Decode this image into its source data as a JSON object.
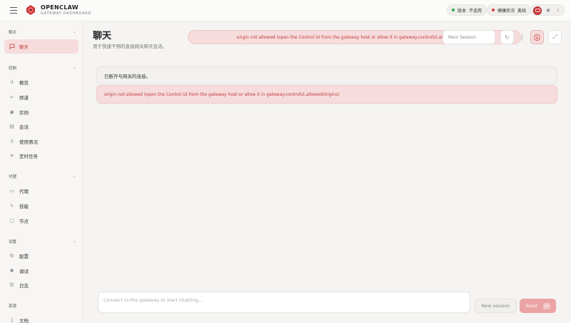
{
  "app": {
    "brand_title": "OPENCLAW",
    "brand_subtitle": "GATEWAY DASHBOARD",
    "accent": "#c23b3b"
  },
  "header": {
    "version_label": "版本",
    "version_value": "不适用",
    "health_label": "健康状况",
    "health_value": "离线",
    "health_color": "#d13b3b",
    "version_color": "#2fa84f"
  },
  "sidebar": {
    "sections": [
      {
        "title": "聊天",
        "items": [
          {
            "label": "聊天",
            "icon": "message-square-icon",
            "active": true
          }
        ]
      },
      {
        "title": "控制",
        "items": [
          {
            "label": "概览",
            "icon": "bar-chart-icon"
          },
          {
            "label": "频道",
            "icon": "link-icon"
          },
          {
            "label": "实例",
            "icon": "radio-icon"
          },
          {
            "label": "会话",
            "icon": "file-text-icon"
          },
          {
            "label": "使用情况",
            "icon": "bar-chart-icon"
          },
          {
            "label": "定时任务",
            "icon": "loader-icon"
          }
        ]
      },
      {
        "title": "代理",
        "items": [
          {
            "label": "代理",
            "icon": "folder-icon"
          },
          {
            "label": "技能",
            "icon": "zap-icon"
          },
          {
            "label": "节点",
            "icon": "monitor-icon"
          }
        ]
      },
      {
        "title": "设置",
        "items": [
          {
            "label": "配置",
            "icon": "gear-icon"
          },
          {
            "label": "调试",
            "icon": "bug-icon"
          },
          {
            "label": "日志",
            "icon": "logs-icon"
          }
        ]
      },
      {
        "title": "资源",
        "items": [
          {
            "label": "文档",
            "icon": "book-icon"
          }
        ]
      }
    ]
  },
  "main": {
    "title": "聊天",
    "subtitle": "用于快速干预的直接网关聊天会话。",
    "error_pill": "origin not allowed (open the Control UI from the gateway host or allow it in gateway.controlUi.allowedOrigins)",
    "session_placeholder": "Main Session",
    "disconnected_message": "已断开与网关的连接。",
    "error_message": "origin not allowed (open the Control UI from the gateway host or allow it in gateway.controlUi.allowedOrigins)",
    "chat_placeholder": "Connect to the gateway to start chatting...",
    "new_session_label": "New session",
    "send_label": "Send",
    "send_shortcut": "↵"
  }
}
